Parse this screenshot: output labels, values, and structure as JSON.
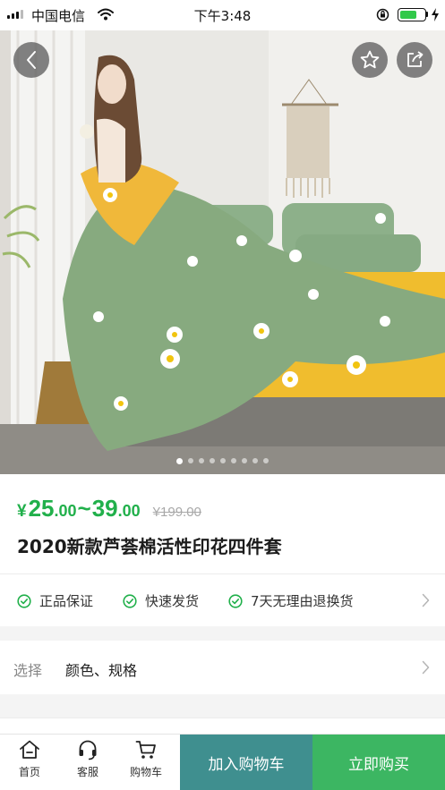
{
  "status_bar": {
    "carrier": "中国电信",
    "time": "下午3:48",
    "battery_level": 0.7
  },
  "product": {
    "price_symbol": "¥",
    "price_low_int": "25",
    "price_low_dec": ".00",
    "price_sep": "~",
    "price_high_int": "39",
    "price_high_dec": ".00",
    "original_price": "¥199.00",
    "title": "2020新款芦荟棉活性印花四件套",
    "image_pager": {
      "count": 9,
      "active": 0
    }
  },
  "guarantees": [
    {
      "label": "正品保证",
      "icon": "check-circle-icon"
    },
    {
      "label": "快速发货",
      "icon": "check-circle-icon"
    },
    {
      "label": "7天无理由退换货",
      "icon": "check-circle-icon"
    }
  ],
  "select": {
    "label": "选择",
    "value": "颜色、规格"
  },
  "bottom_nav": {
    "home": "首页",
    "service": "客服",
    "cart": "购物车",
    "add_to_cart": "加入购物车",
    "buy_now": "立即购买"
  },
  "colors": {
    "price_green": "#21b04b",
    "cart_button": "#3f8f8f",
    "buy_button": "#3cb662",
    "check_green": "#21b04b"
  }
}
